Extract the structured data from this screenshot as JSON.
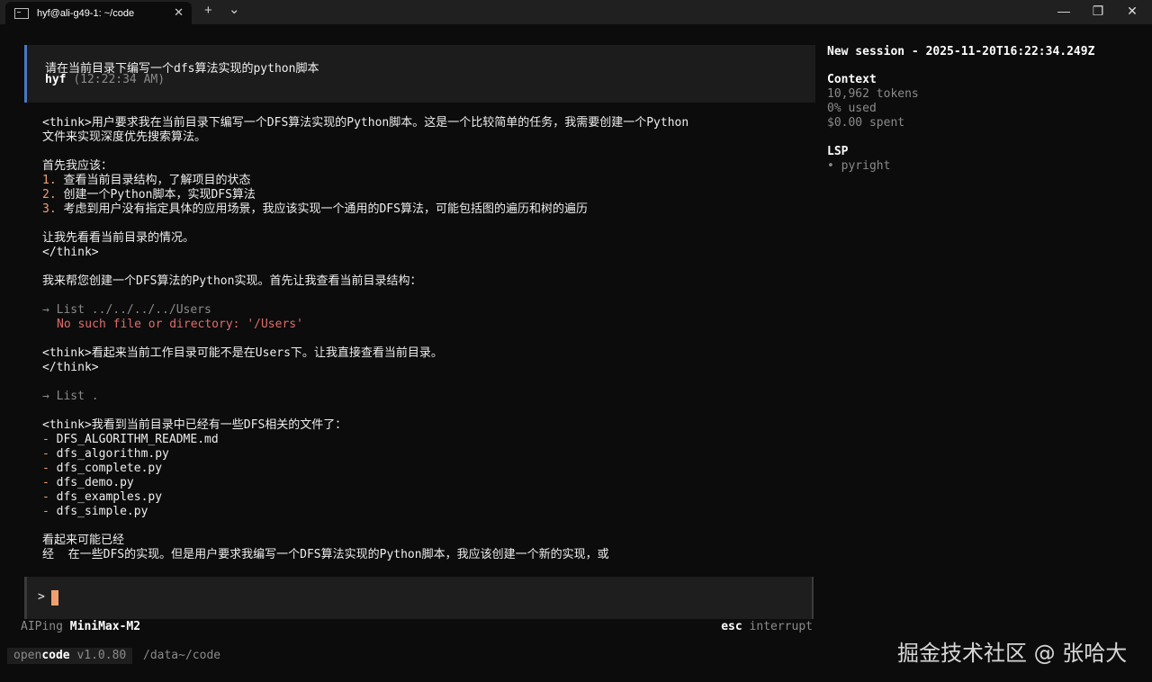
{
  "window": {
    "tab_title": "hyf@ali-g49-1: ~/code",
    "tab_close": "✕",
    "new_tab": "+",
    "dropdown": "⌄",
    "minimize": "—",
    "maximize": "❐",
    "close": "✕"
  },
  "user_message": {
    "text": "请在当前目录下编写一个dfs算法实现的python脚本",
    "author": "hyf",
    "time": "(12:22:34 AM)"
  },
  "assistant": {
    "lines": [
      "<think>用户要求我在当前目录下编写一个DFS算法实现的Python脚本。这是一个比较简单的任务，我需要创建一个Python",
      "文件来实现深度优先搜索算法。",
      "首先我应该：",
      "查看当前目录结构，了解项目的状态",
      "创建一个Python脚本，实现DFS算法",
      "考虑到用户没有指定具体的应用场景，我应该实现一个通用的DFS算法，可能包括图的遍历和树的遍历",
      "让我先看看当前目录的情况。",
      "</think>",
      "我来帮您创建一个DFS算法的Python实现。首先让我查看当前目录结构：",
      "→ List ../../../../Users",
      "No such file or directory: '/Users'",
      "<think>看起来当前工作目录可能不是在Users下。让我直接查看当前目录。",
      "</think>",
      "→ List .",
      "<think>我看到当前目录中已经有一些DFS相关的文件了：",
      "看起来可能已经",
      "经  在一些DFS的实现。但是用户要求我编写一个DFS算法实现的Python脚本，我应该创建一个新的实现，或"
    ],
    "step_numbers": [
      "1.",
      "2.",
      "3."
    ],
    "files": [
      "DFS_ALGORITHM_README.md",
      "dfs_algorithm.py",
      "dfs_complete.py",
      "dfs_demo.py",
      "dfs_examples.py",
      "dfs_simple.py"
    ],
    "dash": "-"
  },
  "input": {
    "prompt": ">"
  },
  "status": {
    "provider": "AIPing",
    "model": "MiniMax-M2",
    "esc_key": "esc",
    "esc_label": "interrupt"
  },
  "bottom": {
    "brand_a": "open",
    "brand_b": "code",
    "version": "v1.0.80",
    "path": "/data~/code"
  },
  "sidebar": {
    "session_title": "New session - 2025-11-20T16:22:34.249Z",
    "context_heading": "Context",
    "tokens": "10,962 tokens",
    "used": "0% used",
    "spent": "$0.00 spent",
    "lsp_heading": "LSP",
    "lsp_item": "• pyright"
  },
  "watermark": "掘金技术社区 @ 张哈大",
  "colors": {
    "accent_orange": "#f0a070",
    "user_border": "#4a78c2",
    "error_red": "#e06c6c"
  }
}
